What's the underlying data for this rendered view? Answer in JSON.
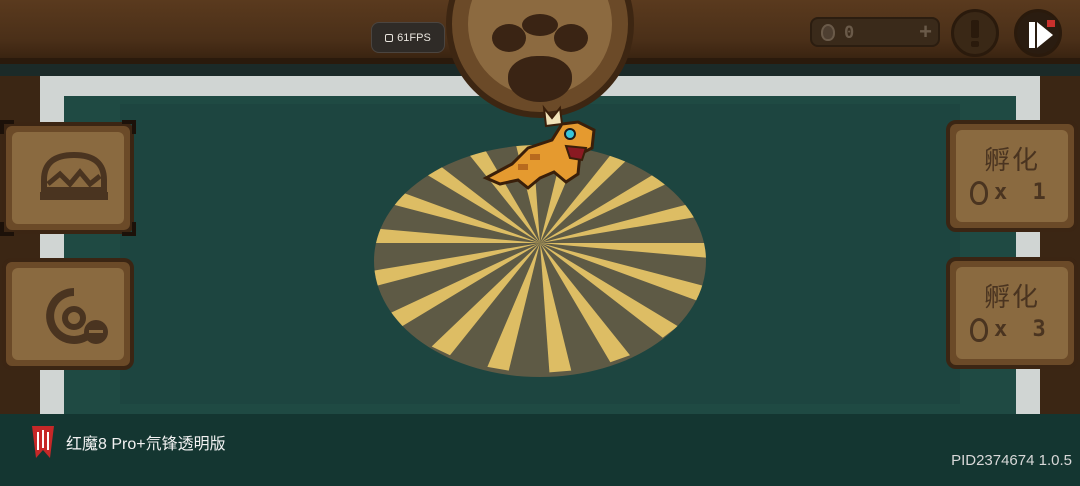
{
  "hud": {
    "fps_label": "61FPS",
    "currency_value": "0",
    "currency_plus": "+"
  },
  "icons": {
    "left_top": "hatchery-nest-icon",
    "left_bottom": "dragon-shop-icon",
    "alert": "exclamation-icon",
    "play": "play-video-icon"
  },
  "hatch_buttons": [
    {
      "title": "孵化",
      "quantity": "x 1"
    },
    {
      "title": "孵化",
      "quantity": "x 3"
    }
  ],
  "device": {
    "brand": "红魔8 Pro+氘锋透明版",
    "pid_version": "PID2374674 1.0.5"
  },
  "colors": {
    "spotlight": "#f3cf6a",
    "dragon_body": "#e59a2f",
    "floor": "#1f4a43",
    "wood": "#6b4a28"
  }
}
